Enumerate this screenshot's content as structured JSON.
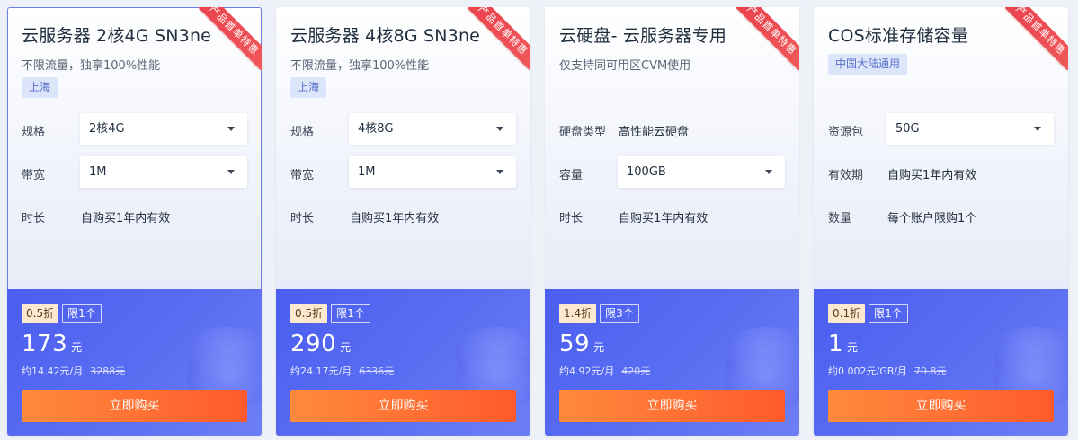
{
  "cards": [
    {
      "ribbon": "产品首单特惠",
      "title": "云服务器 2核4G SN3ne",
      "subtitle": "不限流量，独享100%性能",
      "tag": "上海",
      "row1": {
        "label": "规格",
        "value": "2核4G"
      },
      "row2": {
        "label": "带宽",
        "value": "1M"
      },
      "row3": {
        "label": "时长",
        "value": "自购买1年内有效"
      },
      "discount": "0.5折",
      "limit": "限1个",
      "price": "173",
      "price_unit": "元",
      "monthly": "约14.42元/月",
      "original": "3288元",
      "buy_label": "立即购买"
    },
    {
      "ribbon": "产品首单特惠",
      "title": "云服务器 4核8G SN3ne",
      "subtitle": "不限流量，独享100%性能",
      "tag": "上海",
      "row1": {
        "label": "规格",
        "value": "4核8G"
      },
      "row2": {
        "label": "带宽",
        "value": "1M"
      },
      "row3": {
        "label": "时长",
        "value": "自购买1年内有效"
      },
      "discount": "0.5折",
      "limit": "限1个",
      "price": "290",
      "price_unit": "元",
      "monthly": "约24.17元/月",
      "original": "6336元",
      "buy_label": "立即购买"
    },
    {
      "ribbon": "产品首单特惠",
      "title": "云硬盘- 云服务器专用",
      "subtitle": "仅支持同可用区CVM使用",
      "row1": {
        "label": "硬盘类型",
        "value": "高性能云硬盘"
      },
      "row2": {
        "label": "容量",
        "value": "100GB"
      },
      "row3": {
        "label": "时长",
        "value": "自购买1年内有效"
      },
      "discount": "1.4折",
      "limit": "限3个",
      "price": "59",
      "price_unit": "元",
      "monthly": "约4.92元/月",
      "original": "420元",
      "buy_label": "立即购买"
    },
    {
      "ribbon": "产品首单特惠",
      "title": "COS标准存储容量",
      "tag": "中国大陆通用",
      "row1": {
        "label": "资源包",
        "value": "50G"
      },
      "row2": {
        "label": "有效期",
        "value": "自购买1年内有效"
      },
      "row3": {
        "label": "数量",
        "value": "每个账户限购1个"
      },
      "discount": "0.1折",
      "limit": "限1个",
      "price": "1",
      "price_unit": "元",
      "monthly": "约0.002元/GB/月",
      "original": "70.8元",
      "buy_label": "立即购买"
    }
  ]
}
